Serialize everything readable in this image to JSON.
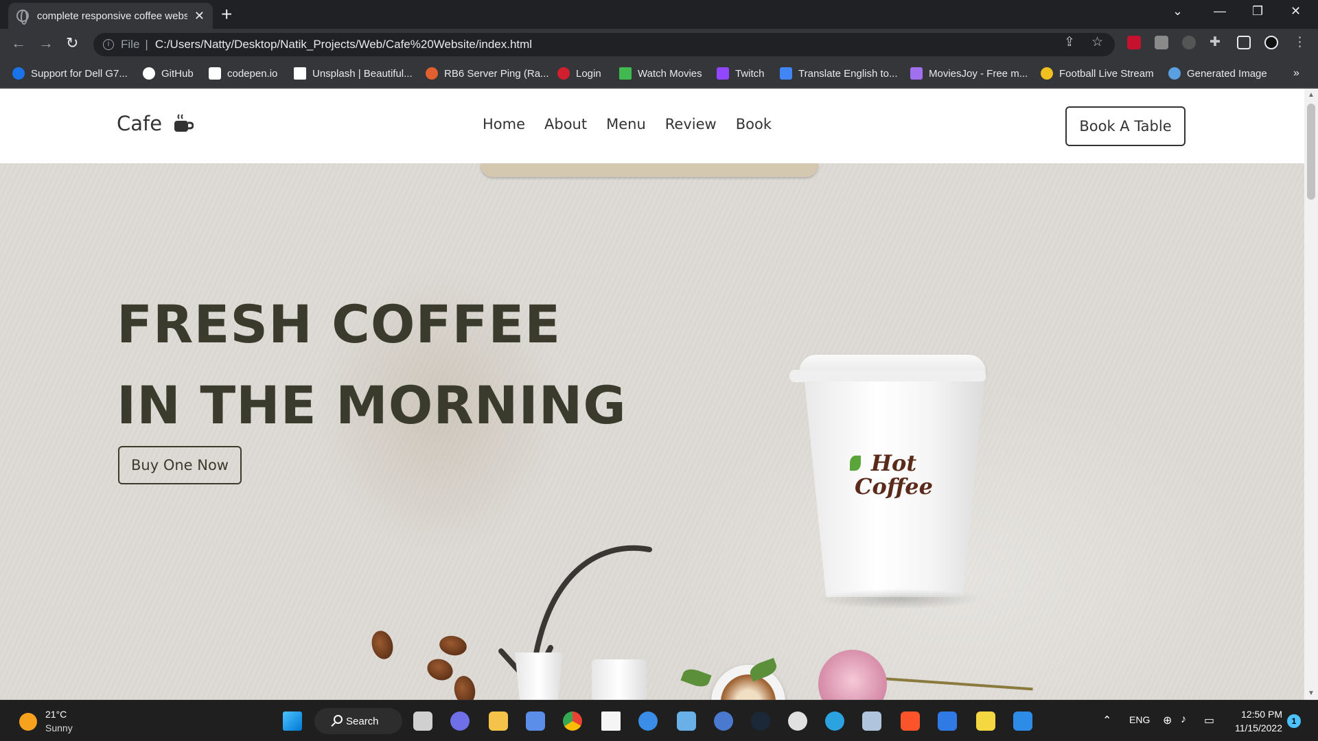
{
  "browser": {
    "tab_title": "complete responsive coffee website",
    "address_scheme": "File",
    "address_url": "C:/Users/Natty/Desktop/Natik_Projects/Web/Cafe%20Website/index.html",
    "bookmarks": [
      {
        "label": "Support for Dell G7...",
        "color": "#1a73e8"
      },
      {
        "label": "GitHub",
        "color": "#ffffff"
      },
      {
        "label": "codepen.io",
        "color": "#ffffff"
      },
      {
        "label": "Unsplash | Beautiful...",
        "color": "#ffffff"
      },
      {
        "label": "RB6 Server Ping (Ra...",
        "color": "#e06030"
      },
      {
        "label": "Login",
        "color": "#d02030"
      },
      {
        "label": "Watch Movies",
        "color": "#3fb950"
      },
      {
        "label": "Twitch",
        "color": "#9146ff"
      },
      {
        "label": "Translate English to...",
        "color": "#4285f4"
      },
      {
        "label": "MoviesJoy - Free m...",
        "color": "#a070f0"
      },
      {
        "label": "Football Live Stream",
        "color": "#f0c020"
      },
      {
        "label": "Generated Image",
        "color": "#5aa0e0"
      }
    ]
  },
  "site": {
    "logo_text": "Cafe",
    "nav": [
      "Home",
      "About",
      "Menu",
      "Review",
      "Book"
    ],
    "cta": "Book A Table",
    "hero_title": "FRESH COFFEE IN THE MORNING",
    "hero_button": "Buy One Now",
    "cup_logo_line1": "Hot",
    "cup_logo_line2": "Coffee"
  },
  "taskbar": {
    "temperature": "21°C",
    "condition": "Sunny",
    "search_label": "Search",
    "language": "ENG",
    "time": "12:50 PM",
    "date": "11/15/2022",
    "notification_count": "1"
  }
}
